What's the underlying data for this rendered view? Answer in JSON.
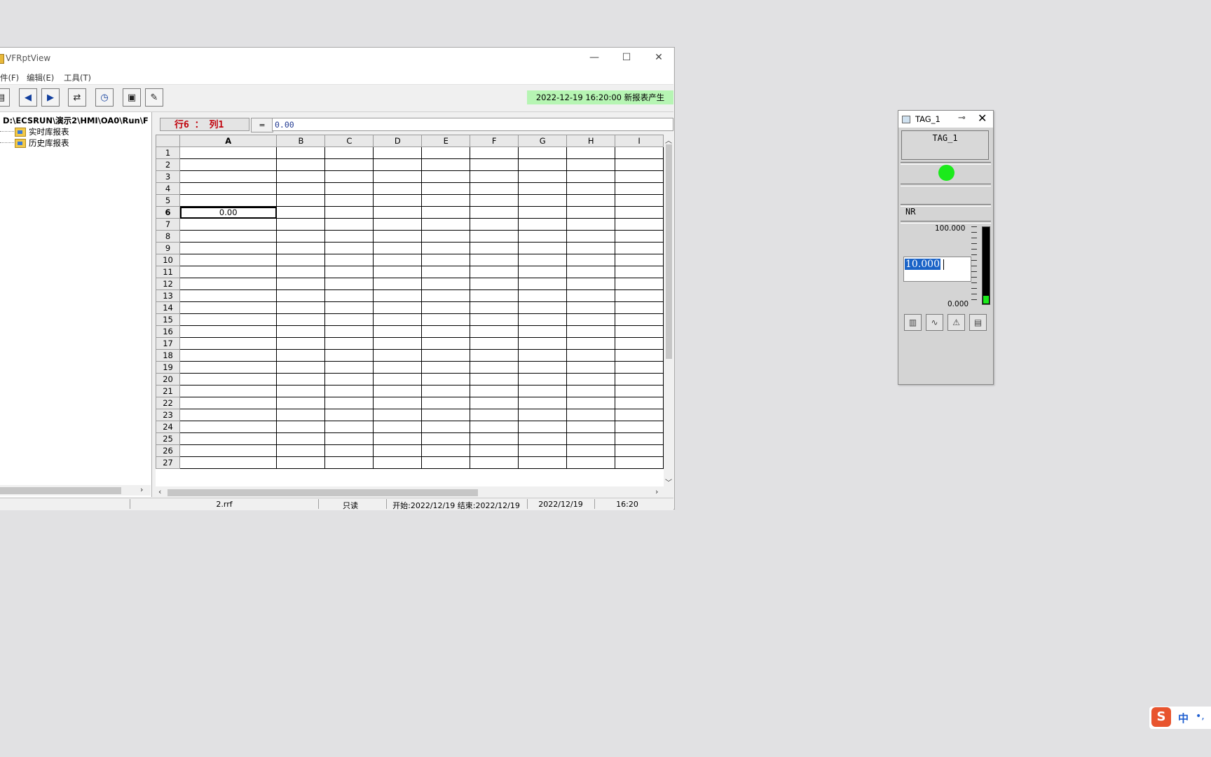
{
  "window": {
    "title": "VFRptView",
    "controls": {
      "minimize": "—",
      "maximize": "☐",
      "close": "✕"
    },
    "menu": [
      "件(F)",
      "编辑(E)",
      "工具(T)"
    ],
    "notice": "2022-12-19 16:20:00 新报表产生"
  },
  "tree": {
    "path": "D:\\ECSRUN\\演示2\\HMI\\OA0\\Run\\F",
    "items": [
      "实时库报表",
      "历史库报表"
    ]
  },
  "formula": {
    "cellref": "行6 ： 列1",
    "eq": "=",
    "value": "0.00"
  },
  "grid": {
    "columns": [
      "A",
      "B",
      "C",
      "D",
      "E",
      "F",
      "G",
      "H",
      "I"
    ],
    "rows": [
      "1",
      "2",
      "3",
      "4",
      "5",
      "6",
      "7",
      "8",
      "9",
      "10",
      "11",
      "12",
      "13",
      "14",
      "15",
      "16",
      "17",
      "18",
      "19",
      "20",
      "21",
      "22",
      "23",
      "24",
      "25",
      "26",
      "27"
    ],
    "active_row": "6",
    "active_col": "A",
    "cells": {
      "6": {
        "A": "0.00"
      }
    }
  },
  "status": {
    "file": "2.rrf",
    "mode": "只读",
    "range": "开始:2022/12/19  结束:2022/12/19",
    "date": "2022/12/19",
    "time": "16:20"
  },
  "tag_panel": {
    "title": "TAG_1",
    "name": "TAG_1",
    "quality": "NR",
    "max": "100.000",
    "min": "0.000",
    "value": "10.000",
    "level_fraction": 0.1,
    "led_color": "#1bea1b"
  },
  "ime": {
    "zh": "中",
    "punct": "•,"
  }
}
